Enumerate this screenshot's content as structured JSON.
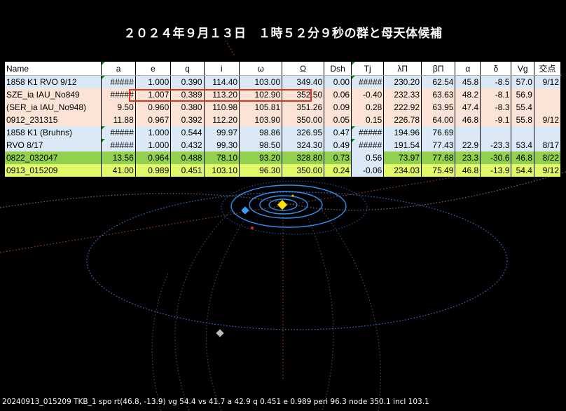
{
  "title": "２０２４年９月１３日　１時５２分９秒の群と母天体候補",
  "table": {
    "headers": [
      "Name",
      "a",
      "e",
      "q",
      "i",
      "ω",
      "Ω",
      "Dsh",
      "Tj",
      "λΠ",
      "βΠ",
      "α",
      "δ",
      "Vg",
      "交点"
    ],
    "rows": [
      {
        "style": "blue",
        "cells": [
          "1858  K1  RVO 9/12",
          "#####",
          "1.000",
          "0.390",
          "114.40",
          "103.00",
          "349.40",
          "0.00",
          "#####",
          "230.20",
          "62.54",
          "45.8",
          "-8.5",
          "57.0",
          "9/12"
        ]
      },
      {
        "style": "peach",
        "cells": [
          "SZE_ia IAU_No849",
          "#####",
          "1.007",
          "0.389",
          "113.20",
          "102.90",
          "352.50",
          "0.06",
          "-0.40",
          "232.33",
          "63.63",
          "48.2",
          "-8.1",
          "56.9",
          ""
        ]
      },
      {
        "style": "peach",
        "cells": [
          "(SER_ia IAU_No948)",
          "9.50",
          "0.960",
          "0.380",
          "110.98",
          "105.81",
          "351.26",
          "0.09",
          "0.28",
          "222.92",
          "63.95",
          "47.4",
          "-8.3",
          "55.4",
          ""
        ]
      },
      {
        "style": "peach",
        "cells": [
          "0912_231315",
          "11.88",
          "0.967",
          "0.392",
          "112.20",
          "103.90",
          "350.00",
          "0.05",
          "0.15",
          "226.78",
          "64.00",
          "46.8",
          "-9.1",
          "55.8",
          "9/12"
        ]
      },
      {
        "style": "blue",
        "cells": [
          "1858  K1  (Bruhns)",
          "#####",
          "1.000",
          "0.544",
          "99.97",
          "98.86",
          "326.95",
          "0.47",
          "#####",
          "194.96",
          "76.69",
          "",
          "",
          "",
          ""
        ]
      },
      {
        "style": "blue",
        "cells": [
          "RVO 8/17",
          "#####",
          "1.000",
          "0.432",
          "99.30",
          "98.50",
          "324.30",
          "0.49",
          "#####",
          "191.54",
          "77.43",
          "22.9",
          "-23.3",
          "53.4",
          "8/17"
        ]
      },
      {
        "style": "green",
        "cells": [
          "0822_032047",
          "13.56",
          "0.964",
          "0.488",
          "78.10",
          "93.20",
          "328.80",
          "0.73",
          "0.56",
          "73.97",
          "77.68",
          "23.3",
          "-30.6",
          "46.8",
          "8/22"
        ]
      },
      {
        "style": "yellow",
        "cells": [
          "0913_015209",
          "41.00",
          "0.989",
          "0.451",
          "103.10",
          "96.30",
          "350.00",
          "0.24",
          "-0.06",
          "234.03",
          "75.49",
          "46.8",
          "-13.9",
          "54.4",
          "9/12"
        ]
      }
    ]
  },
  "status_line": "20240913_015209 TKB_1 spo rt(46.8, -13.9) vg 54.4 vs 41.7 a 42.9 q 0.451 e 0.989 peri 96.3 node 350.1 incl 103.1",
  "colors": {
    "row_blue": "#dbe9f6",
    "row_peach": "#fbe4d5",
    "row_green": "#92d050",
    "row_yellow": "#e2f76a",
    "highlight_box": "#e0301e",
    "orbit_blue": "#3a8fe0",
    "sun": "#ffe000",
    "background": "#000000"
  },
  "icons": [
    "sun-marker",
    "earth-marker",
    "radiant-marker",
    "comet-position-marker"
  ]
}
